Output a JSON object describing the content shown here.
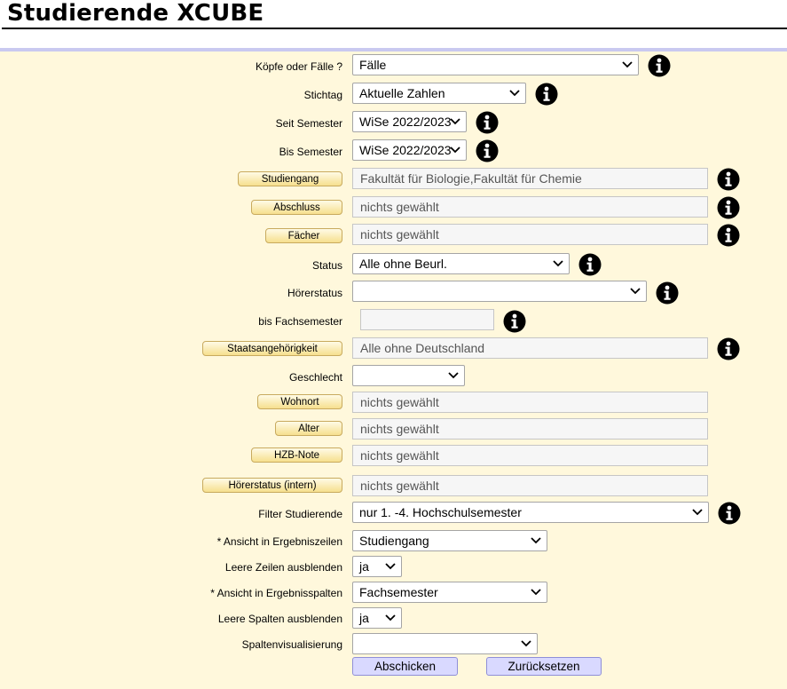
{
  "page": {
    "title": "Studierende XCUBE"
  },
  "form": {
    "koepfe": {
      "label": "Köpfe oder Fälle ?",
      "value": "Fälle"
    },
    "stichtag": {
      "label": "Stichtag",
      "value": "Aktuelle Zahlen"
    },
    "seit": {
      "label": "Seit Semester",
      "value": "WiSe 2022/2023"
    },
    "bis": {
      "label": "Bis Semester",
      "value": "WiSe 2022/2023"
    },
    "studiengang": {
      "button": "Studiengang",
      "value": "Fakultät für Biologie,Fakultät für Chemie"
    },
    "abschluss": {
      "button": "Abschluss",
      "value": "nichts gewählt"
    },
    "faecher": {
      "button": "Fächer",
      "value": "nichts gewählt"
    },
    "status": {
      "label": "Status",
      "value": "Alle ohne Beurl."
    },
    "hoererstatus": {
      "label": "Hörerstatus",
      "value": ""
    },
    "fachsemester": {
      "label": "bis Fachsemester",
      "value": ""
    },
    "staat": {
      "button": "Staatsangehörigkeit",
      "value": "Alle ohne Deutschland"
    },
    "geschlecht": {
      "label": "Geschlecht",
      "value": ""
    },
    "wohnort": {
      "button": "Wohnort",
      "value": "nichts gewählt"
    },
    "alter": {
      "button": "Alter",
      "value": "nichts gewählt"
    },
    "hzb": {
      "button": "HZB-Note",
      "value": "nichts gewählt"
    },
    "hoerer_intern": {
      "button": "Hörerstatus (intern)",
      "value": "nichts gewählt"
    },
    "filter": {
      "label": "Filter Studierende",
      "value": "nur 1. -4. Hochschulsemester"
    },
    "zeilen": {
      "label": "* Ansicht in Ergebniszeilen",
      "value": "Studiengang"
    },
    "leere_zeilen": {
      "label": "Leere Zeilen ausblenden",
      "value": "ja"
    },
    "spalten": {
      "label": "* Ansicht in Ergebnisspalten",
      "value": "Fachsemester"
    },
    "leere_spalten": {
      "label": "Leere Spalten ausblenden",
      "value": "ja"
    },
    "visual": {
      "label": "Spaltenvisualisierung",
      "value": ""
    }
  },
  "actions": {
    "submit": "Abschicken",
    "reset": "Zurücksetzen"
  },
  "icons": {
    "info": "info-icon",
    "chevron": "chevron-down-icon"
  }
}
